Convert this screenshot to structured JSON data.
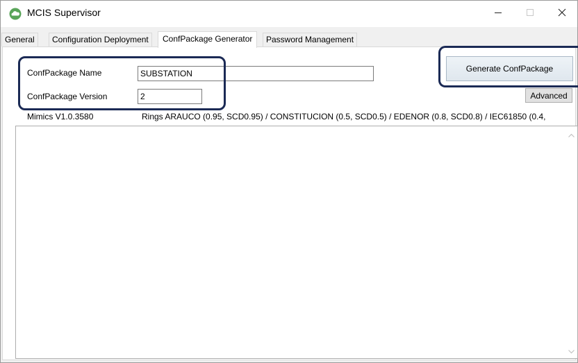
{
  "window": {
    "title": "MCIS Supervisor",
    "icon": "app-cloud-icon",
    "controls": {
      "minimize_icon": "minimize-icon",
      "maximize_icon": "maximize-icon",
      "close_icon": "close-icon"
    }
  },
  "tabs": [
    {
      "label": "General",
      "active": false
    },
    {
      "label": "Configuration Deployment",
      "active": false
    },
    {
      "label": "ConfPackage Generator",
      "active": true
    },
    {
      "label": "Password Management",
      "active": false
    }
  ],
  "form": {
    "name_label": "ConfPackage Name",
    "name_value": "SUBSTATION",
    "version_label": "ConfPackage Version",
    "version_value": "2"
  },
  "buttons": {
    "generate_label": "Generate ConfPackage",
    "advanced_label": "Advanced"
  },
  "info": {
    "mimics_version": "Mimics V1.0.3580",
    "rings_text": "Rings ARAUCO (0.95, SCD0.95) / CONSTITUCION (0.5, SCD0.5) / EDENOR (0.8, SCD0.8) / IEC61850 (0.4,"
  },
  "output": {
    "value": ""
  },
  "colors": {
    "highlight_border": "#1b2a55",
    "app_icon_green": "#5aa55a"
  }
}
